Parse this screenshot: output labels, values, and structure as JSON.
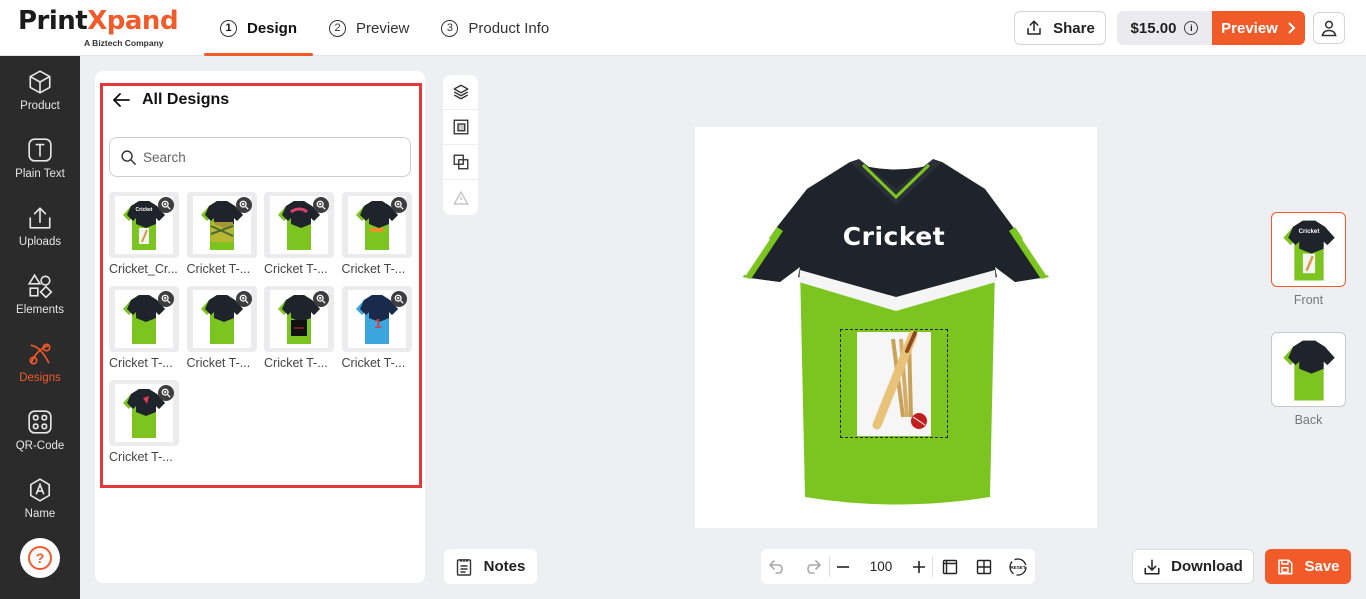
{
  "brand": {
    "name_part1": "Print",
    "name_part2": "Xpand",
    "tagline": "A Biztech Company"
  },
  "steps": [
    {
      "num": "1",
      "label": "Design",
      "active": true
    },
    {
      "num": "2",
      "label": "Preview"
    },
    {
      "num": "3",
      "label": "Product Info"
    }
  ],
  "header": {
    "share_label": "Share",
    "price": "$15.00",
    "preview_label": "Preview"
  },
  "sidebar": {
    "items": [
      {
        "label": "Product",
        "icon": "cube-icon"
      },
      {
        "label": "Plain Text",
        "icon": "text-icon"
      },
      {
        "label": "Uploads",
        "icon": "upload-icon"
      },
      {
        "label": "Elements",
        "icon": "shapes-icon"
      },
      {
        "label": "Designs",
        "icon": "designs-icon",
        "active": true
      },
      {
        "label": "QR-Code",
        "icon": "qr-code-icon"
      },
      {
        "label": "Name",
        "icon": "name-icon"
      }
    ],
    "help_label": "?"
  },
  "panel": {
    "title": "All Designs",
    "search_placeholder": "Search",
    "designs": [
      {
        "label": "Cricket_Cr..."
      },
      {
        "label": "Cricket T-..."
      },
      {
        "label": "Cricket T-..."
      },
      {
        "label": "Cricket T-..."
      },
      {
        "label": "Cricket T-..."
      },
      {
        "label": "Cricket T-..."
      },
      {
        "label": "Cricket T-..."
      },
      {
        "label": "Cricket T-..."
      },
      {
        "label": "Cricket T-..."
      }
    ]
  },
  "canvas": {
    "shirt_text": "Cricket"
  },
  "views": [
    {
      "label": "Front",
      "active": true
    },
    {
      "label": "Back"
    }
  ],
  "bottom": {
    "notes_label": "Notes",
    "zoom_value": "100",
    "reset_label": "RESET",
    "download_label": "Download",
    "save_label": "Save"
  },
  "colors": {
    "accent": "#f15a29",
    "shirt_green": "#7cc520",
    "shirt_dark": "#1f232b",
    "frame_red": "#e5383b"
  }
}
